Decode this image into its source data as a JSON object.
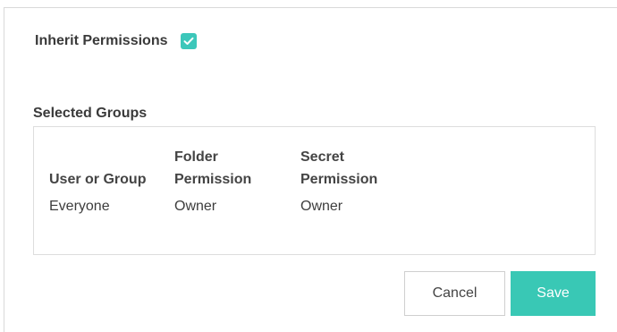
{
  "inherit": {
    "label": "Inherit Permissions",
    "checked": true
  },
  "selected_groups": {
    "title": "Selected Groups",
    "columns": {
      "user_or_group": "User or Group",
      "folder_permission_line1": "Folder",
      "folder_permission_line2": "Permission",
      "secret_permission_line1": "Secret",
      "secret_permission_line2": "Permission"
    },
    "rows": [
      {
        "user_or_group": "Everyone",
        "folder_permission": "Owner",
        "secret_permission": "Owner"
      }
    ]
  },
  "actions": {
    "cancel_label": "Cancel",
    "save_label": "Save"
  },
  "colors": {
    "accent": "#39c8b5",
    "checkbox": "#3cc7ba"
  },
  "icons": {
    "checkbox": "checkmark-icon"
  }
}
